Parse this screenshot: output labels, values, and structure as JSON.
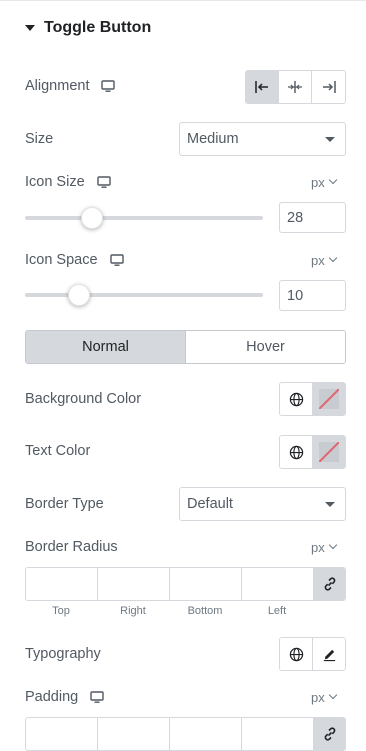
{
  "section": {
    "title": "Toggle Button",
    "icon": "caret-down-icon"
  },
  "alignment": {
    "label": "Alignment",
    "responsive_icon": "monitor-icon",
    "options": [
      "align-start-icon",
      "align-center-icon",
      "align-end-icon"
    ],
    "selected": "align-start-icon"
  },
  "size": {
    "label": "Size",
    "value": "Medium"
  },
  "icon_size": {
    "label": "Icon Size",
    "unit": "px",
    "value": "28",
    "slider_fraction": 0.26
  },
  "icon_space": {
    "label": "Icon Space",
    "unit": "px",
    "value": "10",
    "slider_fraction": 0.2
  },
  "state_tabs": {
    "normal": "Normal",
    "hover": "Hover",
    "active": "Normal"
  },
  "background_color": {
    "label": "Background Color"
  },
  "text_color": {
    "label": "Text Color"
  },
  "border_type": {
    "label": "Border Type",
    "value": "Default"
  },
  "border_radius": {
    "label": "Border Radius",
    "unit": "px",
    "sides": [
      "Top",
      "Right",
      "Bottom",
      "Left"
    ]
  },
  "typography": {
    "label": "Typography"
  },
  "padding": {
    "label": "Padding",
    "unit": "px"
  },
  "colors": {
    "accent_gray": "#d5d8dc",
    "no_color_line": "#e2646e"
  }
}
